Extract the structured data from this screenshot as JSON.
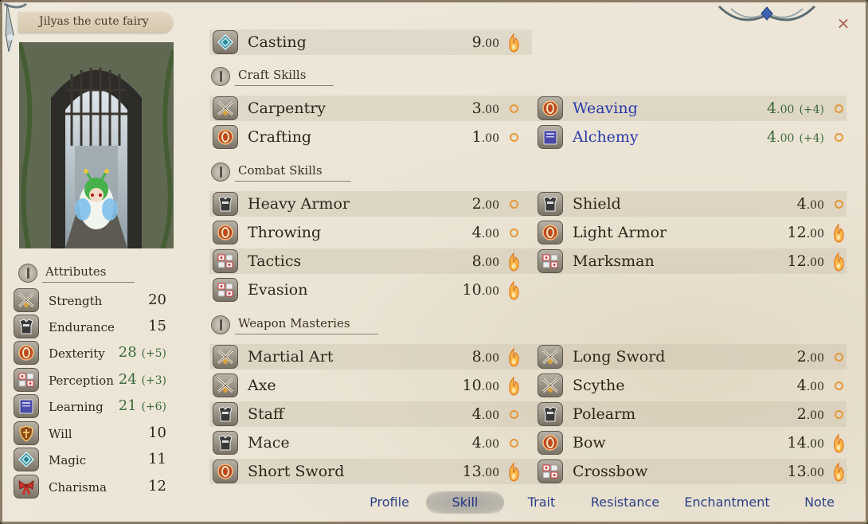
{
  "character": {
    "name": "Jilyas the cute fairy"
  },
  "attributes": {
    "heading": "Attributes",
    "items": [
      {
        "label": "Strength",
        "value": "20",
        "bonus": "",
        "icon": "crossed-swords-icon"
      },
      {
        "label": "Endurance",
        "value": "15",
        "bonus": "",
        "icon": "armor-icon"
      },
      {
        "label": "Dexterity",
        "value": "28",
        "bonus": "(+5)",
        "icon": "shield-ring-icon"
      },
      {
        "label": "Perception",
        "value": "24",
        "bonus": "(+3)",
        "icon": "dice-icon"
      },
      {
        "label": "Learning",
        "value": "21",
        "bonus": "(+6)",
        "icon": "book-icon"
      },
      {
        "label": "Will",
        "value": "10",
        "bonus": "",
        "icon": "heart-shield-icon"
      },
      {
        "label": "Magic",
        "value": "11",
        "bonus": "",
        "icon": "magic-rune-icon"
      },
      {
        "label": "Charisma",
        "value": "12",
        "bonus": "",
        "icon": "bow-ribbon-icon"
      }
    ]
  },
  "skills": {
    "casting": {
      "name": "Casting",
      "value": "9",
      "dec": ".00",
      "potential": "flame",
      "icon": "magic-rune-icon"
    },
    "craft": {
      "heading": "Craft Skills",
      "items": [
        {
          "name": "Carpentry",
          "value": "3",
          "dec": ".00",
          "bonus": "",
          "potential": "ring",
          "icon": "crossed-swords-icon"
        },
        {
          "name": "Weaving",
          "value": "4",
          "dec": ".00",
          "bonus": "(+4)",
          "potential": "ring",
          "icon": "shield-ring-icon",
          "highlight": true
        },
        {
          "name": "Crafting",
          "value": "1",
          "dec": ".00",
          "bonus": "",
          "potential": "ring",
          "icon": "shield-ring-icon"
        },
        {
          "name": "Alchemy",
          "value": "4",
          "dec": ".00",
          "bonus": "(+4)",
          "potential": "ring",
          "icon": "book-icon",
          "highlight": true
        }
      ]
    },
    "combat": {
      "heading": "Combat Skills",
      "items": [
        {
          "name": "Heavy Armor",
          "value": "2",
          "dec": ".00",
          "potential": "ring",
          "icon": "armor-icon"
        },
        {
          "name": "Shield",
          "value": "4",
          "dec": ".00",
          "potential": "ring",
          "icon": "armor-icon"
        },
        {
          "name": "Throwing",
          "value": "4",
          "dec": ".00",
          "potential": "ring",
          "icon": "shield-ring-icon"
        },
        {
          "name": "Light Armor",
          "value": "12",
          "dec": ".00",
          "potential": "flame",
          "icon": "shield-ring-icon"
        },
        {
          "name": "Tactics",
          "value": "8",
          "dec": ".00",
          "potential": "flame",
          "icon": "dice-icon"
        },
        {
          "name": "Marksman",
          "value": "12",
          "dec": ".00",
          "potential": "flame",
          "icon": "dice-icon"
        },
        {
          "name": "Evasion",
          "value": "10",
          "dec": ".00",
          "potential": "flame",
          "icon": "dice-icon"
        }
      ]
    },
    "weapon": {
      "heading": "Weapon Masteries",
      "items": [
        {
          "name": "Martial Art",
          "value": "8",
          "dec": ".00",
          "potential": "flame",
          "icon": "crossed-swords-icon"
        },
        {
          "name": "Long Sword",
          "value": "2",
          "dec": ".00",
          "potential": "ring",
          "icon": "crossed-swords-icon"
        },
        {
          "name": "Axe",
          "value": "10",
          "dec": ".00",
          "potential": "flame",
          "icon": "crossed-swords-icon"
        },
        {
          "name": "Scythe",
          "value": "4",
          "dec": ".00",
          "potential": "ring",
          "icon": "crossed-swords-icon"
        },
        {
          "name": "Staff",
          "value": "4",
          "dec": ".00",
          "potential": "ring",
          "icon": "armor-icon"
        },
        {
          "name": "Polearm",
          "value": "2",
          "dec": ".00",
          "potential": "ring",
          "icon": "armor-icon"
        },
        {
          "name": "Mace",
          "value": "4",
          "dec": ".00",
          "potential": "ring",
          "icon": "armor-icon"
        },
        {
          "name": "Bow",
          "value": "14",
          "dec": ".00",
          "potential": "flame",
          "icon": "shield-ring-icon"
        },
        {
          "name": "Short Sword",
          "value": "13",
          "dec": ".00",
          "potential": "flame",
          "icon": "shield-ring-icon"
        },
        {
          "name": "Crossbow",
          "value": "13",
          "dec": ".00",
          "potential": "flame",
          "icon": "dice-icon"
        }
      ]
    }
  },
  "tabs": [
    {
      "label": "Profile",
      "active": false
    },
    {
      "label": "Skill",
      "active": true
    },
    {
      "label": "Trait",
      "active": false
    },
    {
      "label": "Resistance",
      "active": false
    },
    {
      "label": "Enchantment",
      "active": false
    },
    {
      "label": "Note",
      "active": false
    }
  ],
  "close_label": "×",
  "colors": {
    "bonus_green": "#3c6a3c",
    "highlight_blue": "#2a3aaa",
    "tab_blue": "#2a3f88",
    "potential_orange": "#e39a3a"
  }
}
